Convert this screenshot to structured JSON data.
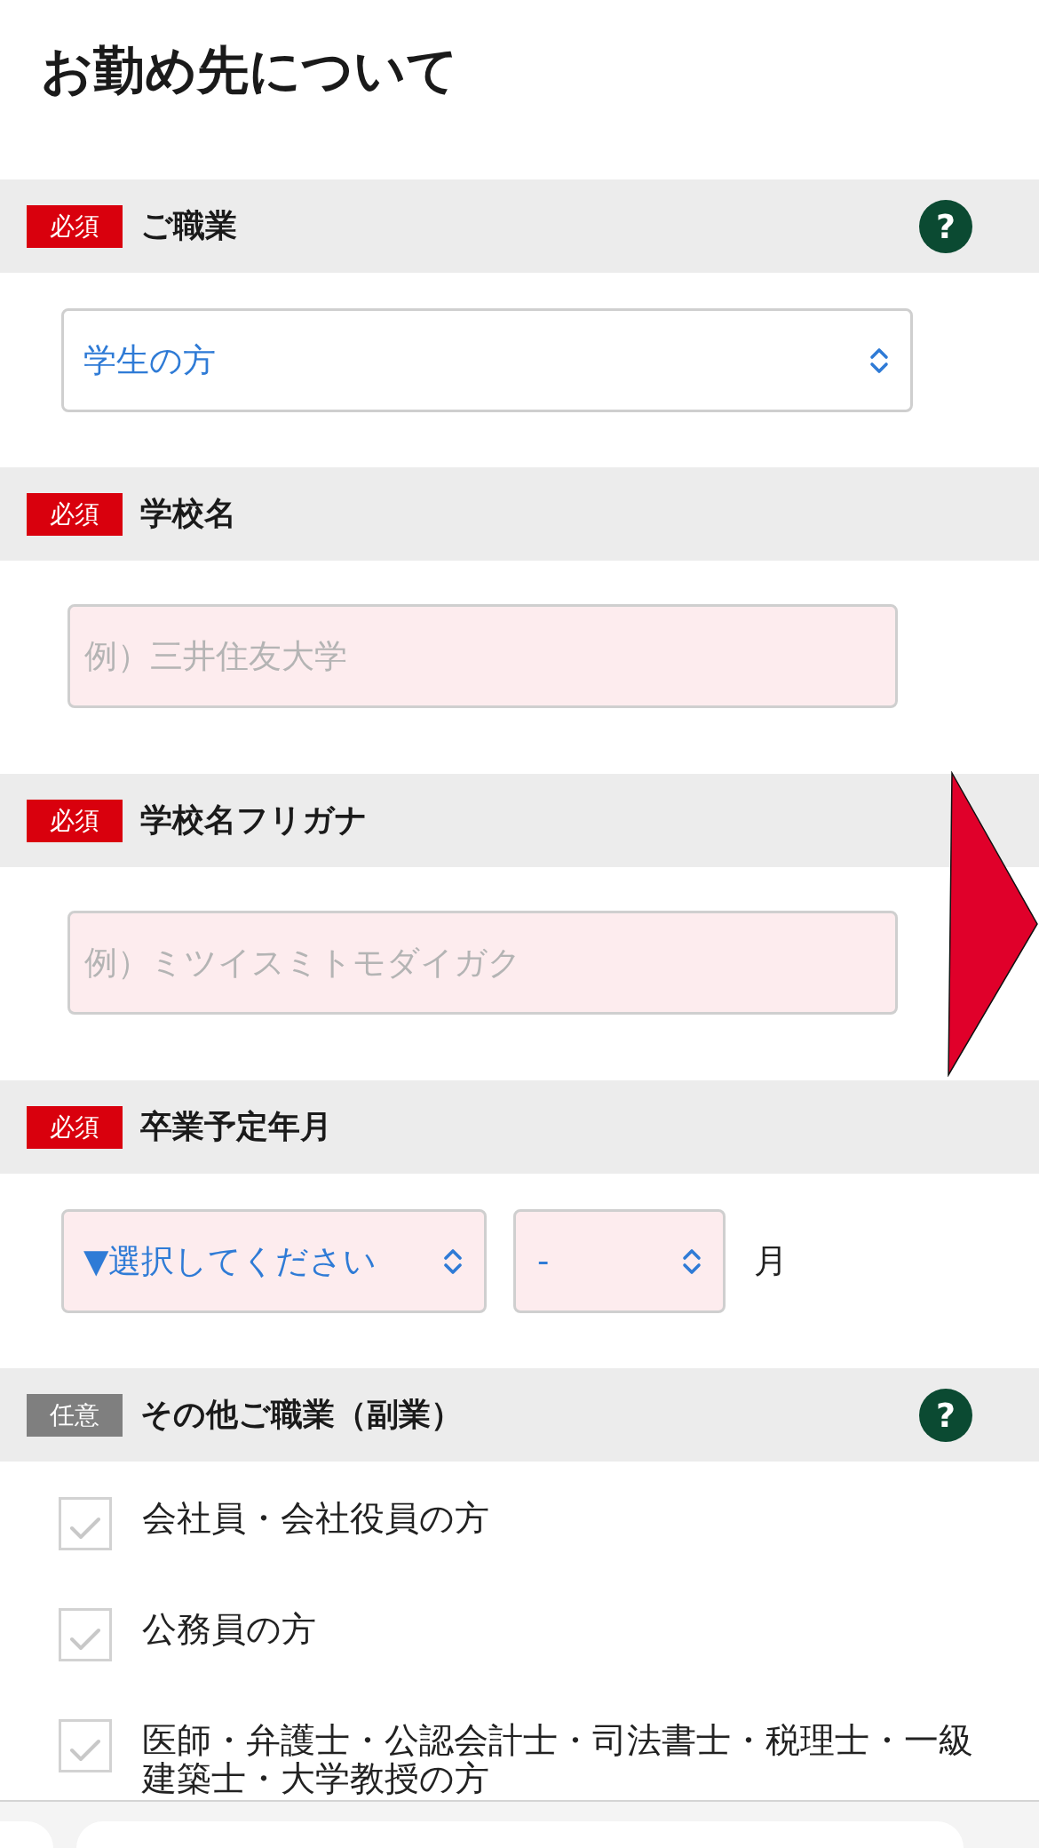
{
  "title": "お勤め先について",
  "sections": [
    {
      "badge": "必須",
      "required": true,
      "label": "ご職業",
      "help": "?",
      "fields": [
        {
          "kind": "select",
          "value": "学生の方",
          "invalid": false
        }
      ]
    },
    {
      "badge": "必須",
      "required": true,
      "label": "学校名",
      "fields": [
        {
          "kind": "text",
          "placeholder": "例）三井住友大学",
          "invalid": true
        }
      ]
    },
    {
      "badge": "必須",
      "required": true,
      "label": "学校名フリガナ",
      "fields": [
        {
          "kind": "text",
          "placeholder": "例）ミツイスミトモダイガク",
          "invalid": true
        }
      ]
    },
    {
      "badge": "必須",
      "required": true,
      "label": "卒業予定年月",
      "fields": [
        {
          "kind": "select",
          "value": "▼選択してください",
          "invalid": true
        },
        {
          "kind": "select",
          "value": "-",
          "invalid": true
        },
        {
          "kind": "unit",
          "text": "月"
        }
      ]
    },
    {
      "badge": "任意",
      "required": false,
      "label": "その他ご職業（副業）",
      "help": "?",
      "fields": [
        {
          "kind": "checkbox",
          "label": "会社員・会社役員の方",
          "checked": false
        },
        {
          "kind": "checkbox",
          "label": "公務員の方",
          "checked": false
        },
        {
          "kind": "checkbox",
          "label": "医師・弁護士・公認会計士・司法書士・税理士・一級建築士・大学教授の方",
          "checked": false
        }
      ]
    }
  ]
}
